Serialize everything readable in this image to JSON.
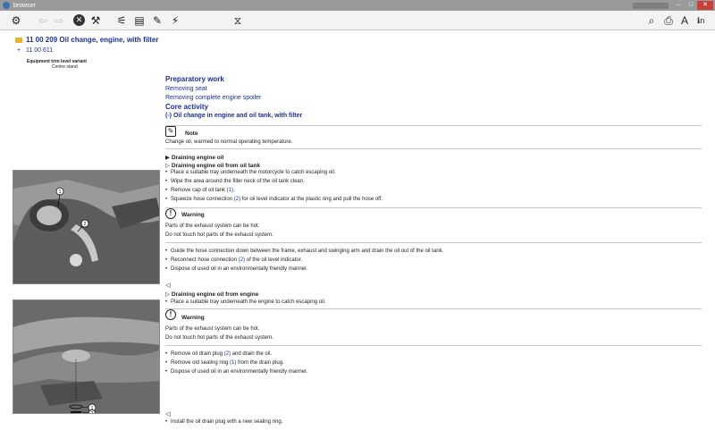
{
  "window": {
    "title": "browser",
    "minimize": "–",
    "maximize": "□",
    "close": "✕"
  },
  "toolbar": {
    "icons": [
      "mechanic-icon",
      "back-icon",
      "forward-icon",
      "stop-icon",
      "tools-icon",
      "wrench-icon",
      "document-icon",
      "connector-icon",
      "screwdriver-icon",
      "filter-icon",
      "search-icon",
      "print-icon",
      "text-size-icon",
      "info-icon"
    ]
  },
  "header": {
    "title": "11 00 209 Oil change, engine, with filter",
    "sub_code": "11 00 611",
    "sub_prefix": "+",
    "variant_label": "Equipment trim level variant",
    "variant_value": "Centre stand"
  },
  "doc": {
    "prep_title": "Preparatory work",
    "prep_links": [
      "Removing seat",
      "Removing complete engine spoiler"
    ],
    "core_title": "Core activity",
    "core_link": "(-) Oil change in engine and oil tank, with filter",
    "note_label": "Note",
    "note_text": "Change oil, warmed to normal operating temperature.",
    "draining_engine_oil": "Draining engine oil",
    "draining_from_tank": "Draining engine oil from oil tank",
    "tank_steps": [
      "Place a suitable tray underneath the motorcycle to catch escaping oil.",
      "Wipe the area around the filler neck of the oil tank clean."
    ],
    "tank_step3_pre": "Remove cap of oil tank ",
    "tank_step3_ref": "(1)",
    "tank_step3_post": ".",
    "tank_step4_pre": "Squeeze hose connection ",
    "tank_step4_ref": "(2)",
    "tank_step4_post": " for oil level indicator at the plastic ring and pull the hose off.",
    "warning_label": "Warning",
    "warning_text1": "Parts of the exhaust system can be hot.",
    "warning_text2": "Do not touch hot parts of the exhaust system.",
    "guide_step": "Guide the hose connection down between the frame, exhaust and swinging arm and drain the oil out of the oil tank.",
    "reconnect_pre": "Reconnect hose connection ",
    "reconnect_ref": "(2)",
    "reconnect_post": " of the oil level indicator.",
    "dispose": "Dispose of used oil in an environmentally friendly manner.",
    "draining_from_engine": "Draining engine oil from engine",
    "engine_tray": "Place a suitable tray underneath the engine to catch escaping oil.",
    "warning2_text1": "Parts of the exhaust system can be hot.",
    "warning2_text2": "Do not touch hot parts of the exhaust system.",
    "remove_plug_pre": "Remove oil drain plug ",
    "remove_plug_ref": "(2)",
    "remove_plug_post": " and drain the oil.",
    "remove_ring_pre": "Remove old sealing ring ",
    "remove_ring_ref": "(1)",
    "remove_ring_post": " from the drain plug.",
    "dispose2": "Dispose of used oil in an environmentally friendly manner.",
    "install_plug": "Install the oil drain plug with a new sealing ring."
  },
  "figures": {
    "fig1_labels": [
      "1",
      "2"
    ],
    "fig2_labels": [
      "1",
      "2"
    ]
  }
}
